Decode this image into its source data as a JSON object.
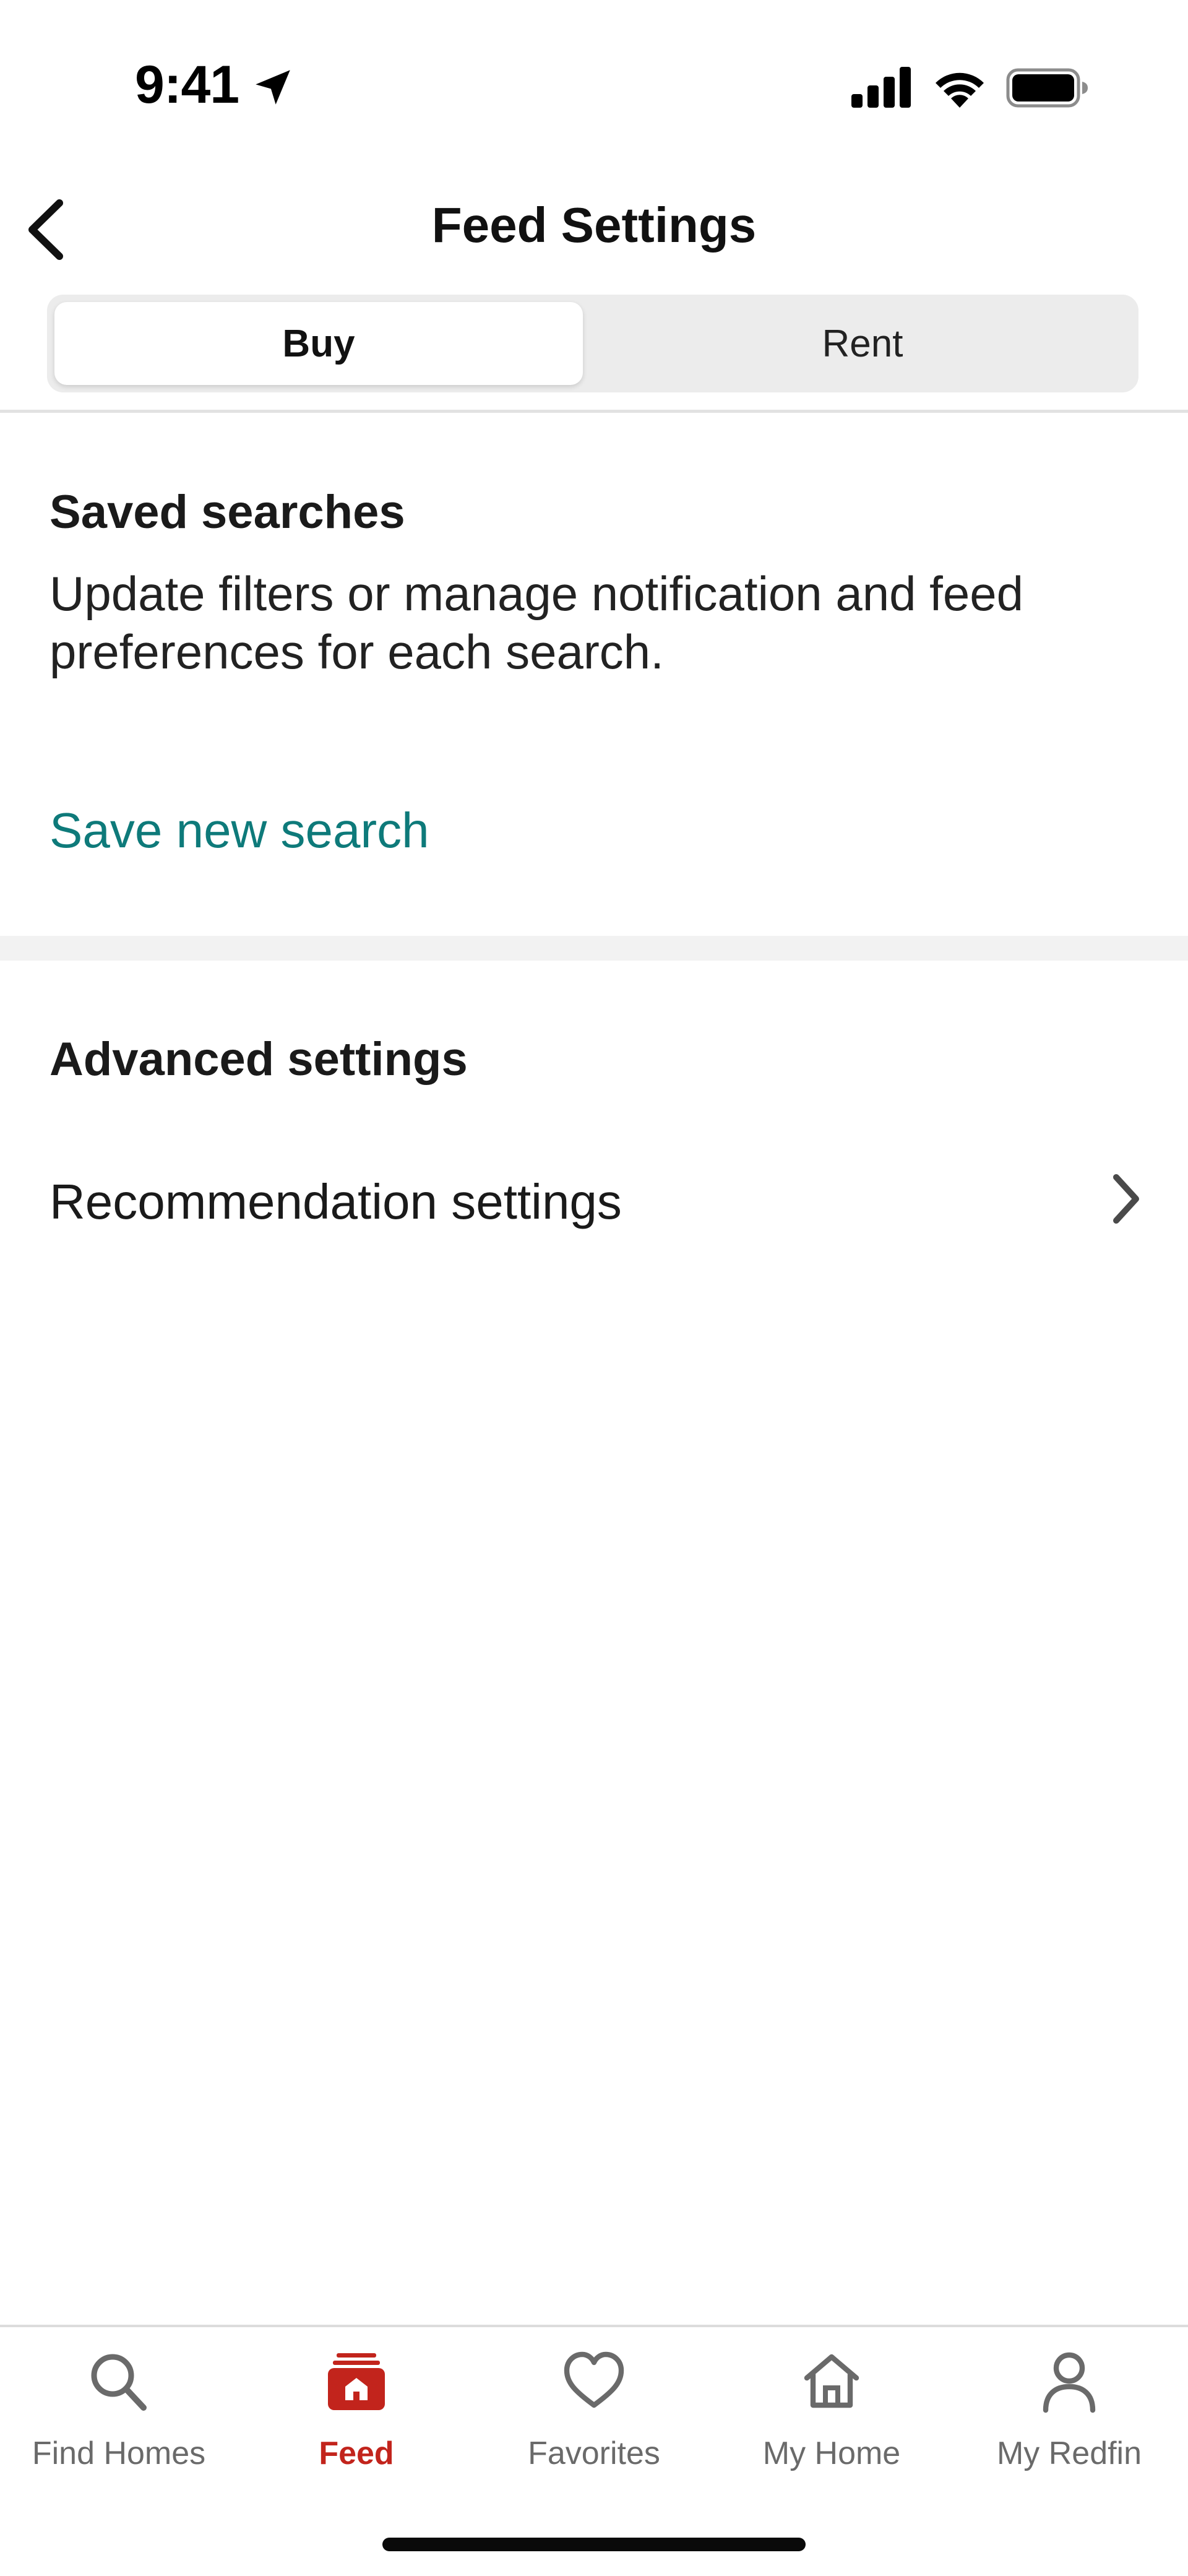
{
  "status_bar": {
    "time": "9:41"
  },
  "header": {
    "title": "Feed Settings",
    "back_icon": "chevron-left-icon"
  },
  "segmented": {
    "options": [
      {
        "label": "Buy",
        "selected": true
      },
      {
        "label": "Rent",
        "selected": false
      }
    ]
  },
  "saved_searches": {
    "heading": "Saved searches",
    "description": "Update filters or manage notification and feed preferences for each search.",
    "save_new_label": "Save new search"
  },
  "advanced": {
    "heading": "Advanced settings",
    "recommendation_label": "Recommendation settings"
  },
  "tab_bar": {
    "tabs": [
      {
        "label": "Find Homes",
        "icon": "search-icon",
        "active": false
      },
      {
        "label": "Feed",
        "icon": "feed-icon",
        "active": true
      },
      {
        "label": "Favorites",
        "icon": "heart-icon",
        "active": false
      },
      {
        "label": "My Home",
        "icon": "home-icon",
        "active": false
      },
      {
        "label": "My Redfin",
        "icon": "person-icon",
        "active": false
      }
    ]
  },
  "colors": {
    "accent_link": "#0e7a7a",
    "active_tab": "#c2241c",
    "inactive_tab": "#6a6a6a"
  }
}
